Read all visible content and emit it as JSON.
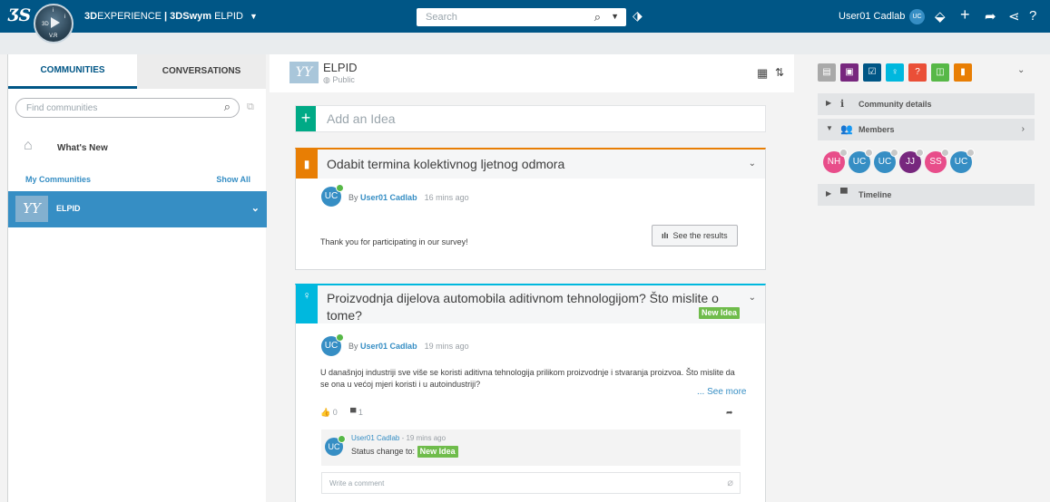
{
  "topbar": {
    "logo": "ƷS",
    "compass_version": "V.R",
    "app_brand": "3D",
    "app_name_bold": "EXPERIENCE",
    "app_name_rest": " | 3DSwym",
    "app_context": "ELPID",
    "search_placeholder": "Search",
    "user_name": "User01 Cadlab",
    "user_initials": "UC"
  },
  "left": {
    "tabs": [
      "COMMUNITIES",
      "CONVERSATIONS"
    ],
    "find_placeholder": "Find communities",
    "whats_new": "What's New",
    "my_communities": "My Communities",
    "show_all": "Show All",
    "community": "ELPID",
    "community_thumb": "YY"
  },
  "center": {
    "name": "ELPID",
    "visibility": "Public",
    "add_idea_placeholder": "Add an Idea",
    "post1": {
      "title": "Odabit termina kolektivnog ljetnog odmora",
      "author_initials": "UC",
      "by": "By",
      "author": "User01 Cadlab",
      "time": "16 mins ago",
      "body": "Thank you for participating in our survey!",
      "button": "See the results",
      "accent": "#e87e04"
    },
    "post2": {
      "title_line1": "Proizvodnja dijelova automobila aditivnom tehnologijom? Što mislite o",
      "title_line2": "tome?",
      "badge": "New Idea",
      "author_initials": "UC",
      "by": "By",
      "author": "User01 Cadlab",
      "time": "19 mins ago",
      "body_line1": "U današnjoj industriji sve više se koristi aditivna tehnologija prilikom proizvodnje i stvaranja proizvoa. Što mislite da",
      "body_line2": "se ona u većoj mjeri koristi i u autoindustriji?",
      "see_more": "... See more",
      "likes": "0",
      "comments": "1",
      "accent": "#00b8de",
      "comment": {
        "author": "User01 Cadlab",
        "time": " - 19 mins ago",
        "status_label": "Status change to:",
        "status_value": "New Idea"
      },
      "write_placeholder": "Write a comment"
    }
  },
  "right": {
    "apps": [
      {
        "name": "feed-icon",
        "color": "#a9a9a9",
        "glyph": "▤"
      },
      {
        "name": "media-icon",
        "color": "#77277e",
        "glyph": "▣"
      },
      {
        "name": "survey-icon",
        "color": "#005686",
        "glyph": "☑"
      },
      {
        "name": "idea-icon",
        "color": "#00b8de",
        "glyph": "♀"
      },
      {
        "name": "question-icon",
        "color": "#ea4f37",
        "glyph": "?"
      },
      {
        "name": "wiki-icon",
        "color": "#57b847",
        "glyph": "◫"
      },
      {
        "name": "clipboard-icon",
        "color": "#e87e04",
        "glyph": "▮"
      }
    ],
    "sections": {
      "details": "Community details",
      "members": "Members",
      "timeline": "Timeline"
    },
    "members": [
      {
        "initials": "NH",
        "color": "#e84d8a"
      },
      {
        "initials": "UC",
        "color": "#368ec4"
      },
      {
        "initials": "UC",
        "color": "#368ec4"
      },
      {
        "initials": "JJ",
        "color": "#77277e"
      },
      {
        "initials": "SS",
        "color": "#e84d8a"
      },
      {
        "initials": "UC",
        "color": "#368ec4"
      }
    ]
  }
}
